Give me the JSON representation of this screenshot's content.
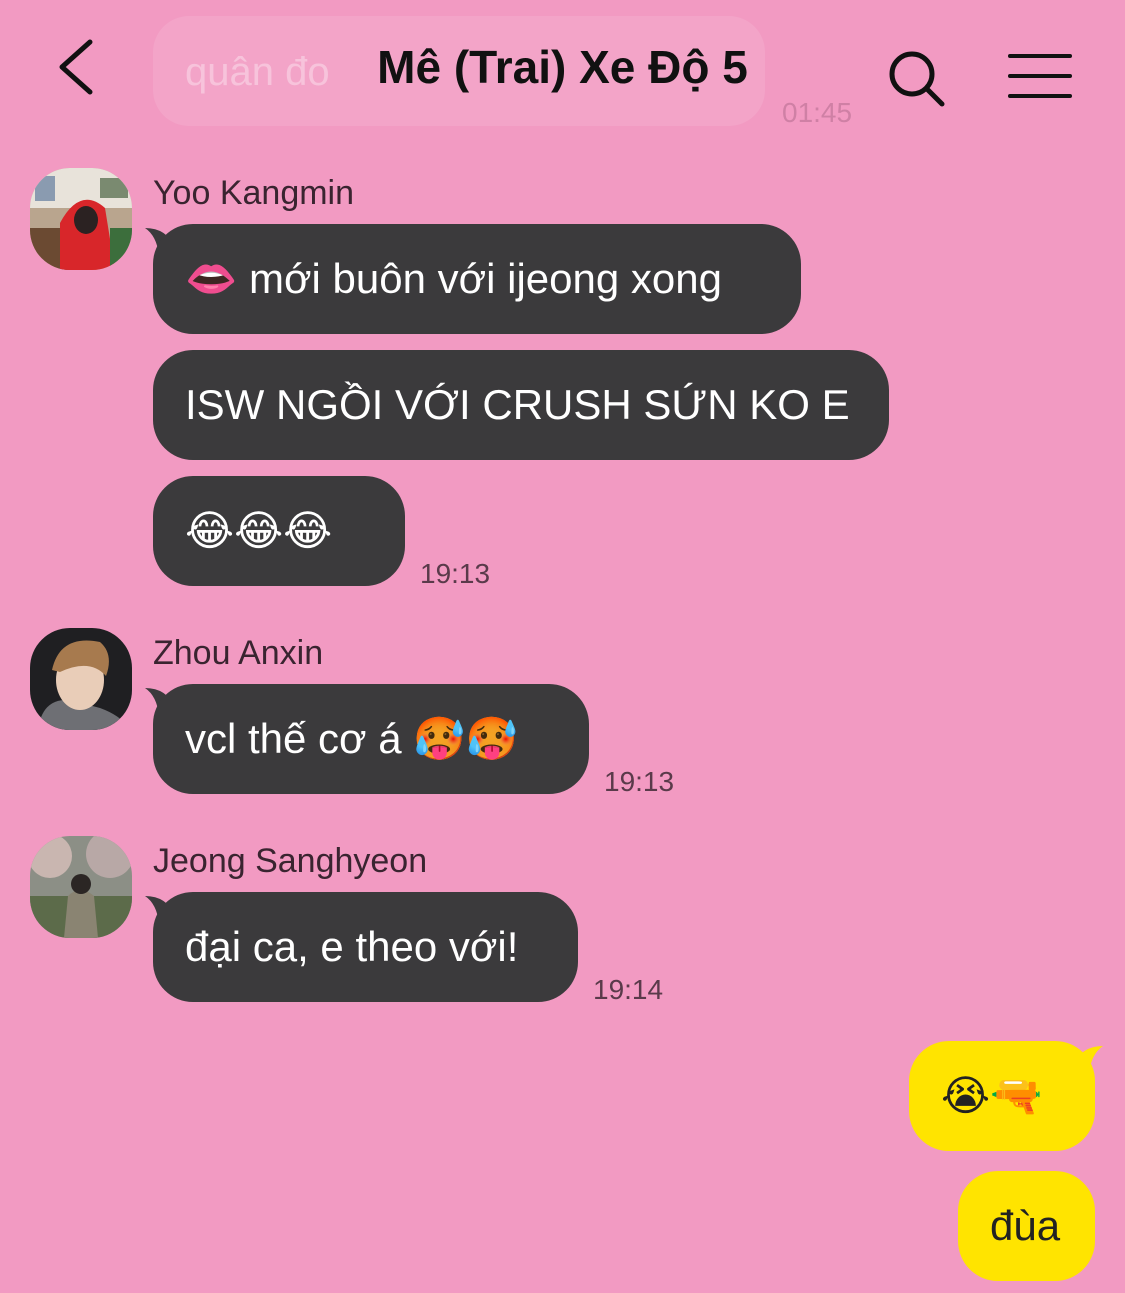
{
  "header": {
    "title": "Mê (Trai) Xe Độ 5",
    "back_icon": "chevron-left-icon",
    "search_icon": "search-icon",
    "menu_icon": "hamburger-menu-icon"
  },
  "previous_message": {
    "text": "quân đo",
    "time": "01:45"
  },
  "colors": {
    "background": "#F29AC2",
    "incoming_bubble": "#3B3A3C",
    "outgoing_bubble": "#FFE400"
  },
  "messages": [
    {
      "sender": "Yoo Kangmin",
      "avatar": "avatar-red-hoodie",
      "bubbles": [
        {
          "text": "👄 mới buôn với ijeong xong"
        },
        {
          "text": "ISW NGỒI VỚI CRUSH SỨN KO E"
        },
        {
          "text": "😂😂😂"
        }
      ],
      "time": "19:13"
    },
    {
      "sender": "Zhou Anxin",
      "avatar": "avatar-portrait",
      "bubbles": [
        {
          "text": "vcl thế cơ á 🥵🥵"
        }
      ],
      "time": "19:13"
    },
    {
      "sender": "Jeong Sanghyeon",
      "avatar": "avatar-outdoor",
      "bubbles": [
        {
          "text": "đại ca, e theo với!"
        }
      ],
      "time": "19:14"
    }
  ],
  "my_messages": [
    {
      "text": "😭🔫"
    },
    {
      "text": "đùa"
    }
  ]
}
